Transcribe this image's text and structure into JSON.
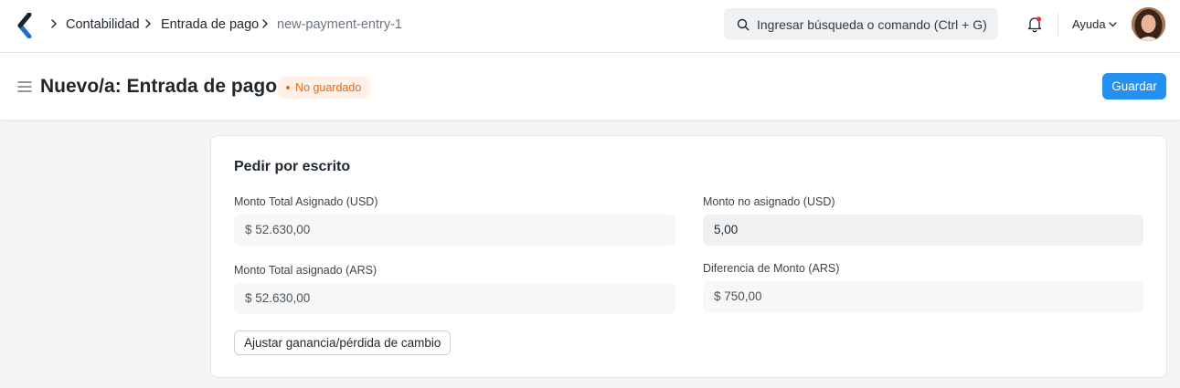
{
  "navbar": {
    "breadcrumbs": [
      "Contabilidad",
      "Entrada de pago",
      "new-payment-entry-1"
    ],
    "search_placeholder": "Ingresar búsqueda o comando (Ctrl + G)",
    "help_label": "Ayuda",
    "icons": [
      "app-logo-icon",
      "chevron-right-icon",
      "search-icon",
      "bell-icon",
      "chevron-down-icon"
    ]
  },
  "header": {
    "title": "Nuevo/a: Entrada de pago",
    "status_badge": "No guardado",
    "save_label": "Guardar"
  },
  "section": {
    "title": "Pedir por escrito",
    "fields": [
      {
        "label": "Monto Total Asignado (USD)",
        "value": "$ 52.630,00"
      },
      {
        "label": "Monto no asignado (USD)",
        "value": "5,00"
      },
      {
        "label": "Monto Total asignado (ARS)",
        "value": "$ 52.630,00"
      },
      {
        "label": "Diferencia de Monto (ARS)",
        "value": "$ 750,00"
      }
    ],
    "action_label": "Ajustar ganancia/pérdida de cambio"
  },
  "colors": {
    "primary": "#2490ef",
    "badge_text": "#e86c13",
    "badge_bg": "#fff1e7",
    "logo": "#2490ef"
  }
}
